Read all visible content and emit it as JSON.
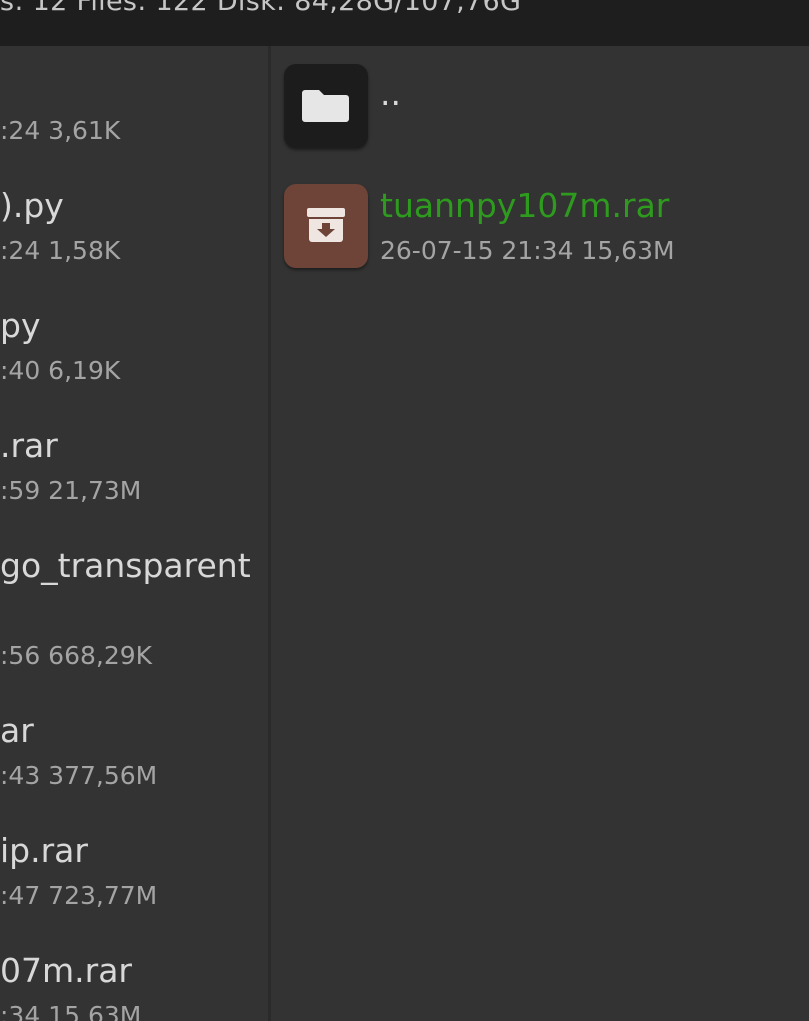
{
  "status_bar": {
    "text": "s: 12  Files: 122  Disk: 84,28G/107,76G"
  },
  "left_pane": {
    "items": [
      {
        "name": "",
        "meta": ":24  3,61K"
      },
      {
        "name": ").py",
        "meta": ":24  1,58K"
      },
      {
        "name": "py",
        "meta": ":40  6,19K"
      },
      {
        "name": ".rar",
        "meta": ":59  21,73M"
      },
      {
        "name": "go_transparent",
        "meta": ":56  668,29K"
      },
      {
        "name": "ar",
        "meta": ":43  377,56M"
      },
      {
        "name": "ip.rar",
        "meta": ":47  723,77M"
      },
      {
        "name": "07m.rar",
        "meta": ":34  15,63M"
      }
    ]
  },
  "right_pane": {
    "items": [
      {
        "name": "..",
        "meta": "",
        "icon": "folder-icon",
        "tile_color": "#1c1c1c",
        "name_color": "#d8d8d8"
      },
      {
        "name": "tuannpy107m.rar",
        "meta": "26-07-15 21:34  15,63M",
        "icon": "archive-icon",
        "tile_color": "#6d4437",
        "name_color": "#2e9b1f"
      }
    ]
  }
}
